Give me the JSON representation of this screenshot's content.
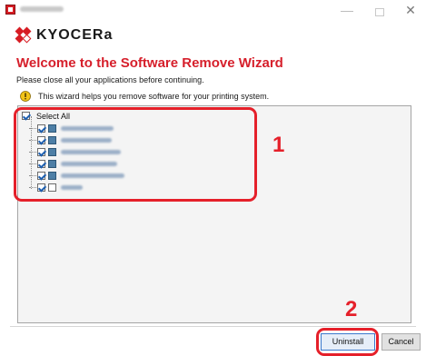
{
  "window": {
    "minimize_glyph": "—",
    "close_glyph": "✕"
  },
  "brand": {
    "logo_text": "KYOCERa",
    "logo_color": "#d71d24"
  },
  "header": {
    "title": "Welcome to the Software Remove Wizard",
    "instruction": "Please close all your applications before continuing.",
    "info": "This wizard helps you remove software for your printing system.",
    "title_color": "#d61f2b"
  },
  "software_list": {
    "select_all_label": "Select All",
    "select_all_checked": true,
    "items": [
      {
        "checked": true,
        "icon": "package-icon"
      },
      {
        "checked": true,
        "icon": "package-icon"
      },
      {
        "checked": true,
        "icon": "package-icon"
      },
      {
        "checked": true,
        "icon": "package-icon"
      },
      {
        "checked": true,
        "icon": "package-icon"
      },
      {
        "checked": true,
        "icon": "document-icon"
      }
    ]
  },
  "annotations": {
    "callout_1": "1",
    "callout_2": "2",
    "color": "#e5202a"
  },
  "footer": {
    "uninstall_label": "Uninstall",
    "cancel_label": "Cancel"
  }
}
